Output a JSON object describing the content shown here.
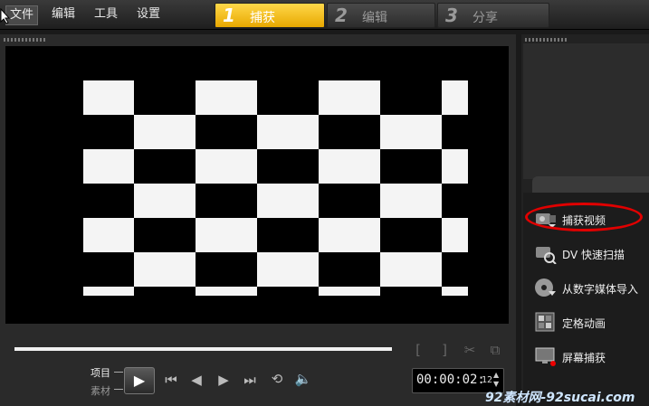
{
  "menu": {
    "file": "文件",
    "edit": "编辑",
    "tools": "工具",
    "settings": "设置"
  },
  "steps": [
    {
      "num": "1",
      "label": "捕获",
      "active": true
    },
    {
      "num": "2",
      "label": "编辑",
      "active": false
    },
    {
      "num": "3",
      "label": "分享",
      "active": false
    }
  ],
  "controls": {
    "mode_project": "项目",
    "mode_clip": "素材",
    "timecode": "00:00:02:",
    "timecode_frames": "12",
    "icons": [
      "play-icon",
      "go-to-start-icon",
      "previous-frame-icon",
      "next-frame-icon",
      "go-to-end-icon",
      "repeat-icon",
      "volume-icon",
      "mark-in-icon",
      "mark-out-icon",
      "split-icon",
      "copy-icon"
    ]
  },
  "capture_actions": [
    {
      "label": "捕获视频",
      "icon": "capture-video-icon"
    },
    {
      "label": "DV 快速扫描",
      "icon": "dv-quick-scan-icon"
    },
    {
      "label": "从数字媒体导入",
      "icon": "import-from-digital-media-icon"
    },
    {
      "label": "定格动画",
      "icon": "stop-motion-icon"
    },
    {
      "label": "屏幕捕获",
      "icon": "screen-capture-icon"
    }
  ],
  "watermark": "92素材网-92sucai.com",
  "colors": {
    "accent": "#f0b400",
    "highlight": "#e10000"
  }
}
